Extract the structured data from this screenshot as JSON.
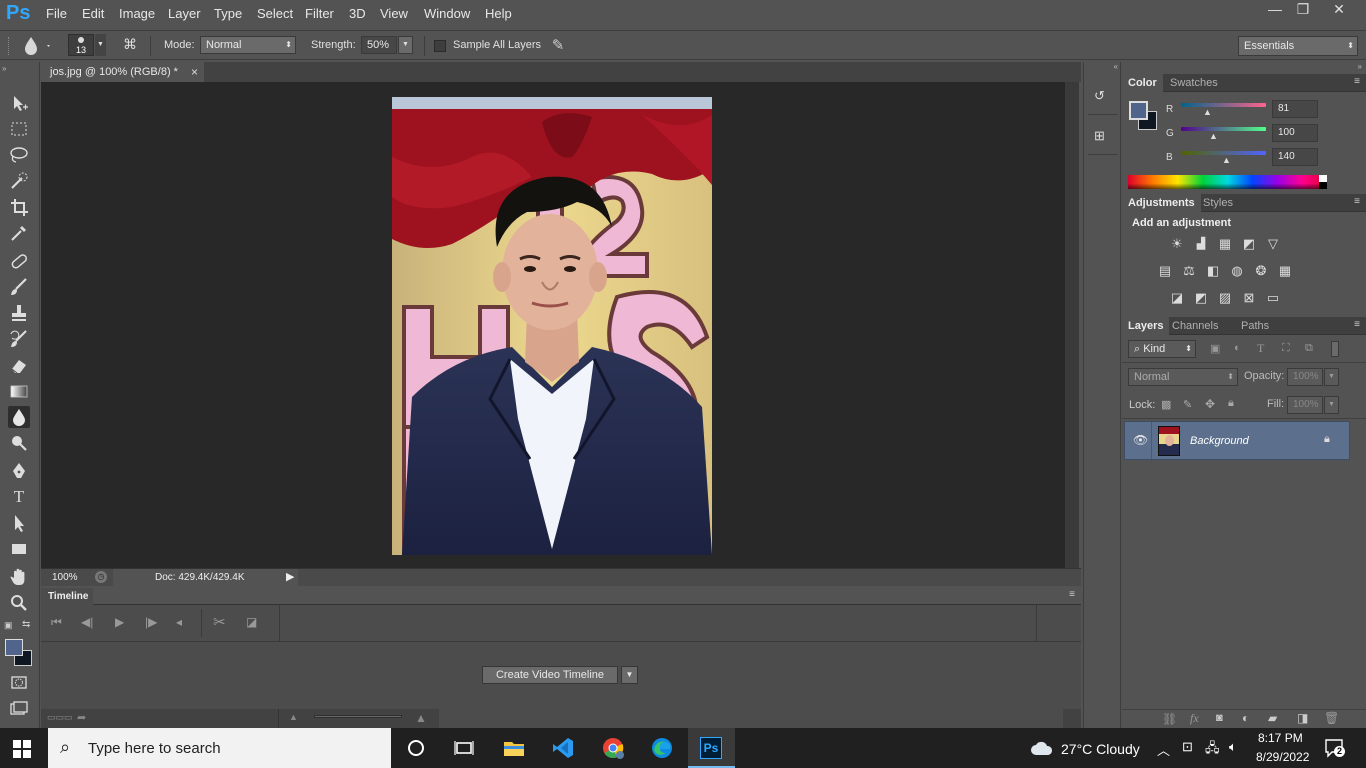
{
  "app": {
    "logo": "Ps"
  },
  "menu": [
    "File",
    "Edit",
    "Image",
    "Layer",
    "Type",
    "Select",
    "Filter",
    "3D",
    "View",
    "Window",
    "Help"
  ],
  "window_controls": {
    "minimize": "—",
    "restore": "❐",
    "close": "✕"
  },
  "options_bar": {
    "brush_size": "13",
    "mode_label": "Mode:",
    "mode_value": "Normal",
    "strength_label": "Strength:",
    "strength_value": "50%",
    "sample_all_layers": "Sample All Layers",
    "sample_all_layers_checked": false,
    "workspace": "Essentials"
  },
  "document": {
    "tab_title": "jos.jpg @ 100% (RGB/8) *",
    "close": "×",
    "zoom": "100%",
    "doc_info": "Doc: 429.4K/429.4K"
  },
  "timeline": {
    "title": "Timeline",
    "create_button": "Create Video Timeline"
  },
  "color_panel": {
    "tabs": [
      "Color",
      "Swatches"
    ],
    "foreground_color": "#51648c",
    "r": {
      "label": "R",
      "value": "81"
    },
    "g": {
      "label": "G",
      "value": "100"
    },
    "b": {
      "label": "B",
      "value": "140"
    }
  },
  "adjustments_panel": {
    "tabs": [
      "Adjustments",
      "Styles"
    ],
    "heading": "Add an adjustment"
  },
  "layers_panel": {
    "tabs": [
      "Layers",
      "Channels",
      "Paths"
    ],
    "filter_kind": "Kind",
    "blend_mode": "Normal",
    "opacity_label": "Opacity:",
    "opacity_value": "100%",
    "lock_label": "Lock:",
    "fill_label": "Fill:",
    "fill_value": "100%",
    "layers": [
      {
        "name": "Background",
        "visible": true,
        "locked": true
      }
    ]
  },
  "taskbar": {
    "search_placeholder": "Type here to search",
    "weather": "27°C  Cloudy",
    "time": "8:17 PM",
    "date": "8/29/2022",
    "notifications": "2"
  }
}
